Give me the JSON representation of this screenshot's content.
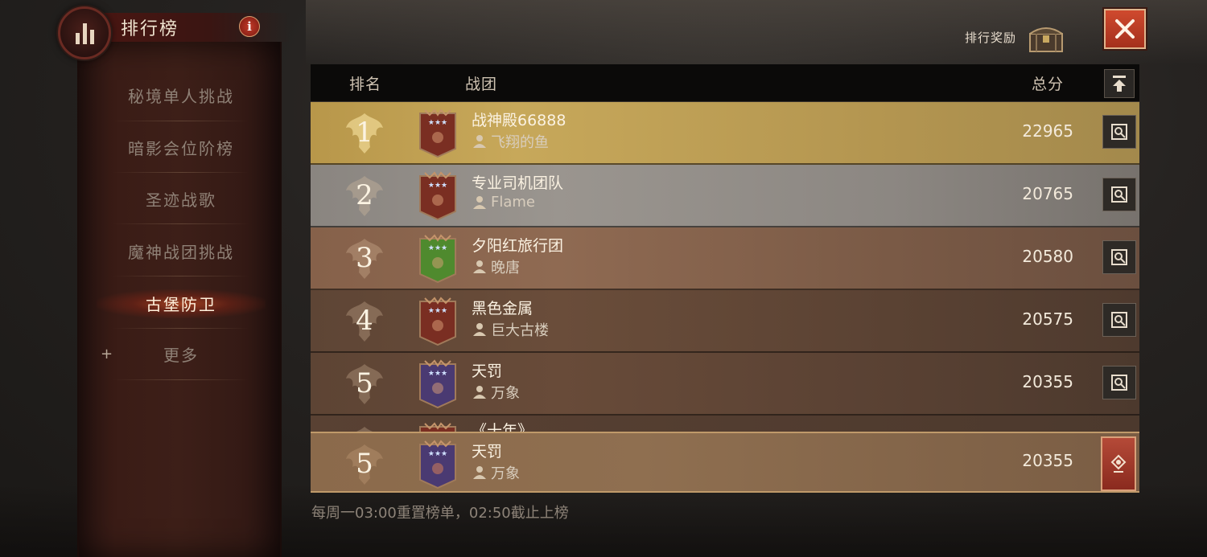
{
  "header": {
    "title": "排行榜",
    "info_label": "i"
  },
  "sidebar": {
    "items": [
      {
        "label": "秘境单人挑战",
        "active": false
      },
      {
        "label": "暗影会位阶榜",
        "active": false
      },
      {
        "label": "圣迹战歌",
        "active": false
      },
      {
        "label": "魔神战团挑战",
        "active": false
      },
      {
        "label": "古堡防卫",
        "active": true
      },
      {
        "label": "更多",
        "active": false
      }
    ],
    "more_prefix": "+"
  },
  "top_right": {
    "reward_label": "排行奖励"
  },
  "table": {
    "headers": {
      "rank": "排名",
      "guild": "战团",
      "score": "总分"
    },
    "rows": [
      {
        "rank": "1",
        "guild": "战神殿66888",
        "leader": "飞翔的鱼",
        "score": "22965",
        "banner_color": "#7a2e22"
      },
      {
        "rank": "2",
        "guild": "专业司机团队",
        "leader": "Flame",
        "score": "20765",
        "banner_color": "#7a2e22"
      },
      {
        "rank": "3",
        "guild": "夕阳红旅行团",
        "leader": "晚唐",
        "score": "20580",
        "banner_color": "#4f8a2e"
      },
      {
        "rank": "4",
        "guild": "黑色金属",
        "leader": "巨大古楼",
        "score": "20575",
        "banner_color": "#7a2e22"
      },
      {
        "rank": "5",
        "guild": "天罚",
        "leader": "万象",
        "score": "20355",
        "banner_color": "#4a3a72"
      },
      {
        "rank": "",
        "guild": "《十年》",
        "leader": "",
        "score": "",
        "banner_color": "#7a2e22"
      }
    ],
    "my_guild": {
      "rank": "5",
      "guild": "天罚",
      "leader": "万象",
      "score": "20355",
      "banner_color": "#4a3a72"
    }
  },
  "footer": {
    "note": "每周一03:00重置榜单，02:50截止上榜"
  },
  "colors": {
    "accent_red": "#c23a28",
    "gold_row": "#c7a85a",
    "silver_row": "#9a958f",
    "bronze_row": "#8f6a52"
  }
}
